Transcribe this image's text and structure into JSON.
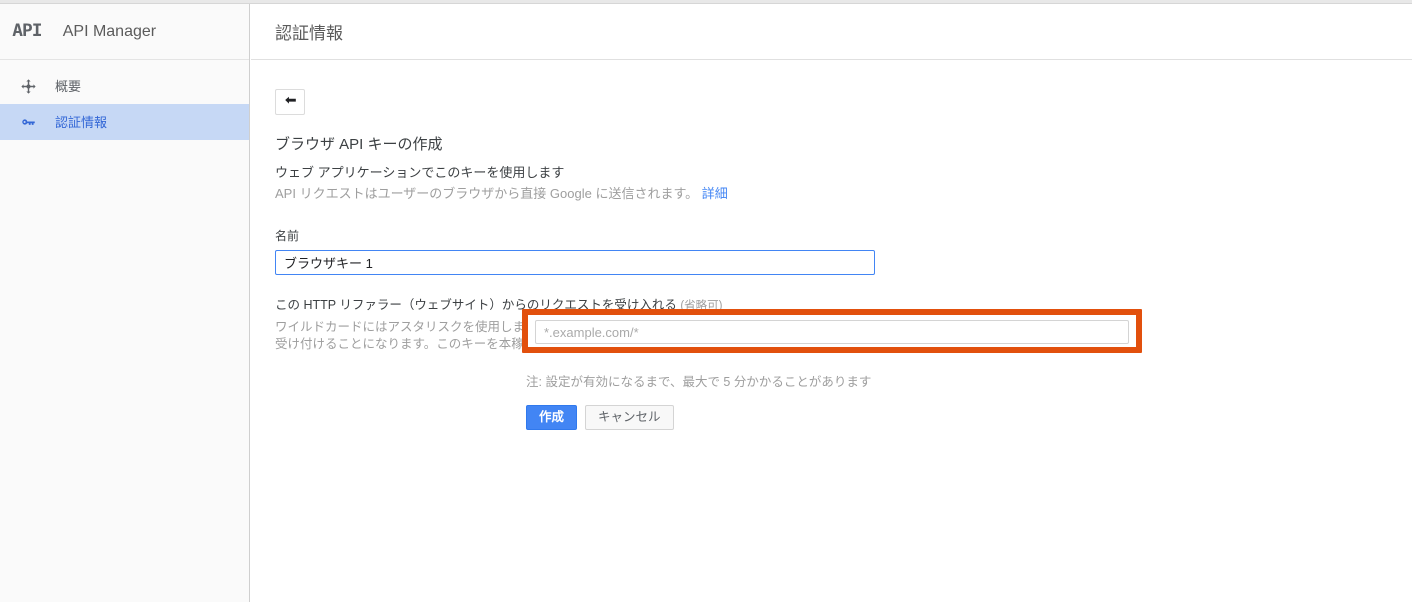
{
  "colors": {
    "accent_blue": "#4285f4",
    "nav_active_bg": "#c6d8f5",
    "nav_active_text": "#3367d6",
    "highlight_orange": "#e2500d",
    "muted_text": "#9e9e9e"
  },
  "sidebar": {
    "logo_text": "API",
    "app_title": "API Manager",
    "items": [
      {
        "label": "概要",
        "icon": "dashboard-overview-icon",
        "active": false
      },
      {
        "label": "認証情報",
        "icon": "key-icon",
        "active": true
      }
    ]
  },
  "header": {
    "title": "認証情報"
  },
  "content": {
    "back_button_icon": "back-arrow-icon",
    "section_title": "ブラウザ API キーの作成",
    "subtitle": "ウェブ アプリケーションでこのキーを使用します",
    "description": "API リクエストはユーザーのブラウザから直接 Google に送信されます。",
    "description_link": "詳細",
    "name_field": {
      "label": "名前",
      "value": "ブラウザキー 1",
      "placeholder": ""
    },
    "referrer_field": {
      "label": "この HTTP リファラー（ウェブサイト）からのリクエストを受け入れる",
      "optional_tag": "(省略可)",
      "help_text": "ワイルドカードにはアスタリスクを使用します。ここを空欄にすると、どのリファラーからのリクエストも受け付けることになります。このキーを本稼働環境で使用する前に、必ずリファラーを指定してください",
      "placeholder": "*.example.com/*",
      "value": ""
    },
    "note": "注: 設定が有効になるまで、最大で 5 分かかることがあります",
    "buttons": {
      "create": "作成",
      "cancel": "キャンセル"
    }
  }
}
